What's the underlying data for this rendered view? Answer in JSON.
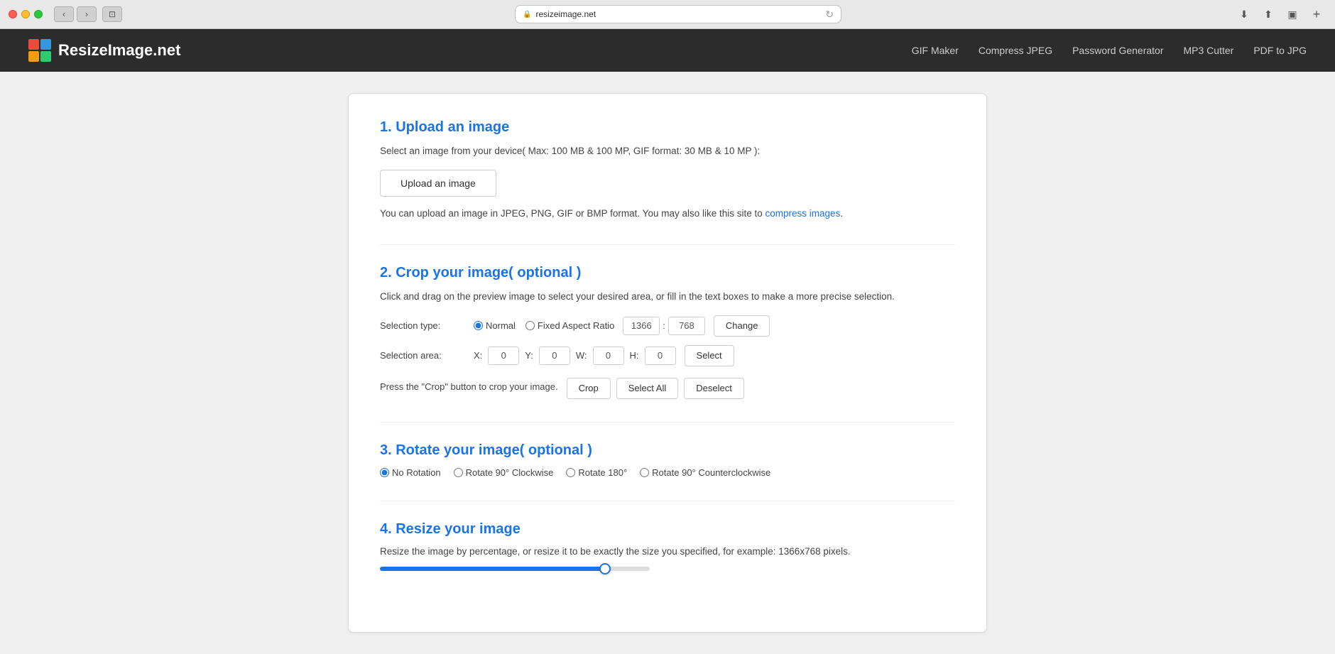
{
  "browser": {
    "url": "resizeimage.net",
    "reload_icon": "↻"
  },
  "navbar": {
    "logo_text": "ResizeImage.net",
    "nav_items": [
      {
        "label": "GIF Maker",
        "id": "gif-maker"
      },
      {
        "label": "Compress JPEG",
        "id": "compress-jpeg"
      },
      {
        "label": "Password Generator",
        "id": "password-generator"
      },
      {
        "label": "MP3 Cutter",
        "id": "mp3-cutter"
      },
      {
        "label": "PDF to JPG",
        "id": "pdf-to-jpg"
      }
    ]
  },
  "sections": {
    "upload": {
      "title": "1. Upload an image",
      "desc": "Select an image from your device( Max: 100 MB & 100 MP, GIF format: 30 MB & 10 MP ):",
      "button_label": "Upload an image",
      "note": "You can upload an image in JPEG, PNG, GIF or BMP format. You may also like this site to ",
      "link_text": "compress images",
      "note_end": "."
    },
    "crop": {
      "title": "2. Crop your image( optional )",
      "desc": "Click and drag on the preview image to select your desired area, or fill in the text boxes to make a more precise selection.",
      "selection_type_label": "Selection type:",
      "normal_label": "Normal",
      "fixed_aspect_label": "Fixed Aspect Ratio",
      "aspect_w": "1366",
      "aspect_h": "768",
      "change_btn": "Change",
      "selection_area_label": "Selection area:",
      "x_label": "X:",
      "x_value": "0",
      "y_label": "Y:",
      "y_value": "0",
      "w_label": "W:",
      "w_value": "0",
      "h_label": "H:",
      "h_value": "0",
      "select_btn": "Select",
      "press_label": "Press the \"Crop\" button to crop your image.",
      "crop_btn": "Crop",
      "select_all_btn": "Select All",
      "deselect_btn": "Deselect"
    },
    "rotate": {
      "title": "3. Rotate your image( optional )",
      "options": [
        {
          "label": "No Rotation",
          "value": "none",
          "checked": true
        },
        {
          "label": "Rotate 90° Clockwise",
          "value": "cw90",
          "checked": false
        },
        {
          "label": "Rotate 180°",
          "value": "180",
          "checked": false
        },
        {
          "label": "Rotate 90° Counterclockwise",
          "value": "ccw90",
          "checked": false
        }
      ]
    },
    "resize": {
      "title": "4. Resize your image",
      "desc": "Resize the image by percentage, or resize it to be exactly the size you specified, for example: 1366x768 pixels.",
      "slider_value": 85
    }
  }
}
